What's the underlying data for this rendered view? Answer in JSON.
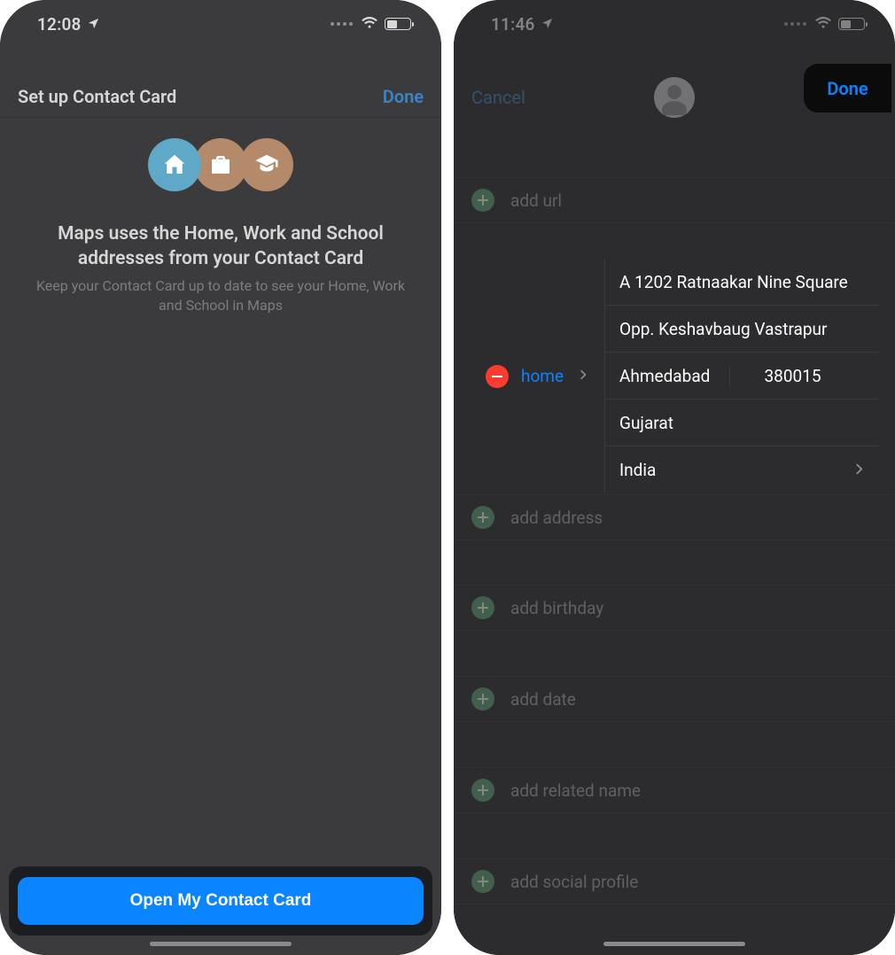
{
  "left": {
    "status_time": "12:08",
    "title": "Set up Contact Card",
    "done": "Done",
    "headline": "Maps uses the Home, Work and School addresses from your Contact Card",
    "subline": "Keep your Contact Card up to date to see your Home, Work and School in Maps",
    "open_button": "Open My Contact Card"
  },
  "right": {
    "status_time": "11:46",
    "cancel": "Cancel",
    "done": "Done",
    "rows": {
      "add_url": "add url",
      "add_address": "add address",
      "add_birthday": "add birthday",
      "add_date": "add date",
      "add_related": "add related name",
      "add_social": "add social profile"
    },
    "address": {
      "label": "home",
      "line1": "A 1202 Ratnaakar Nine Square",
      "line2": "Opp. Keshavbaug Vastrapur",
      "city": "Ahmedabad",
      "postal": "380015",
      "state": "Gujarat",
      "country": "India"
    }
  }
}
